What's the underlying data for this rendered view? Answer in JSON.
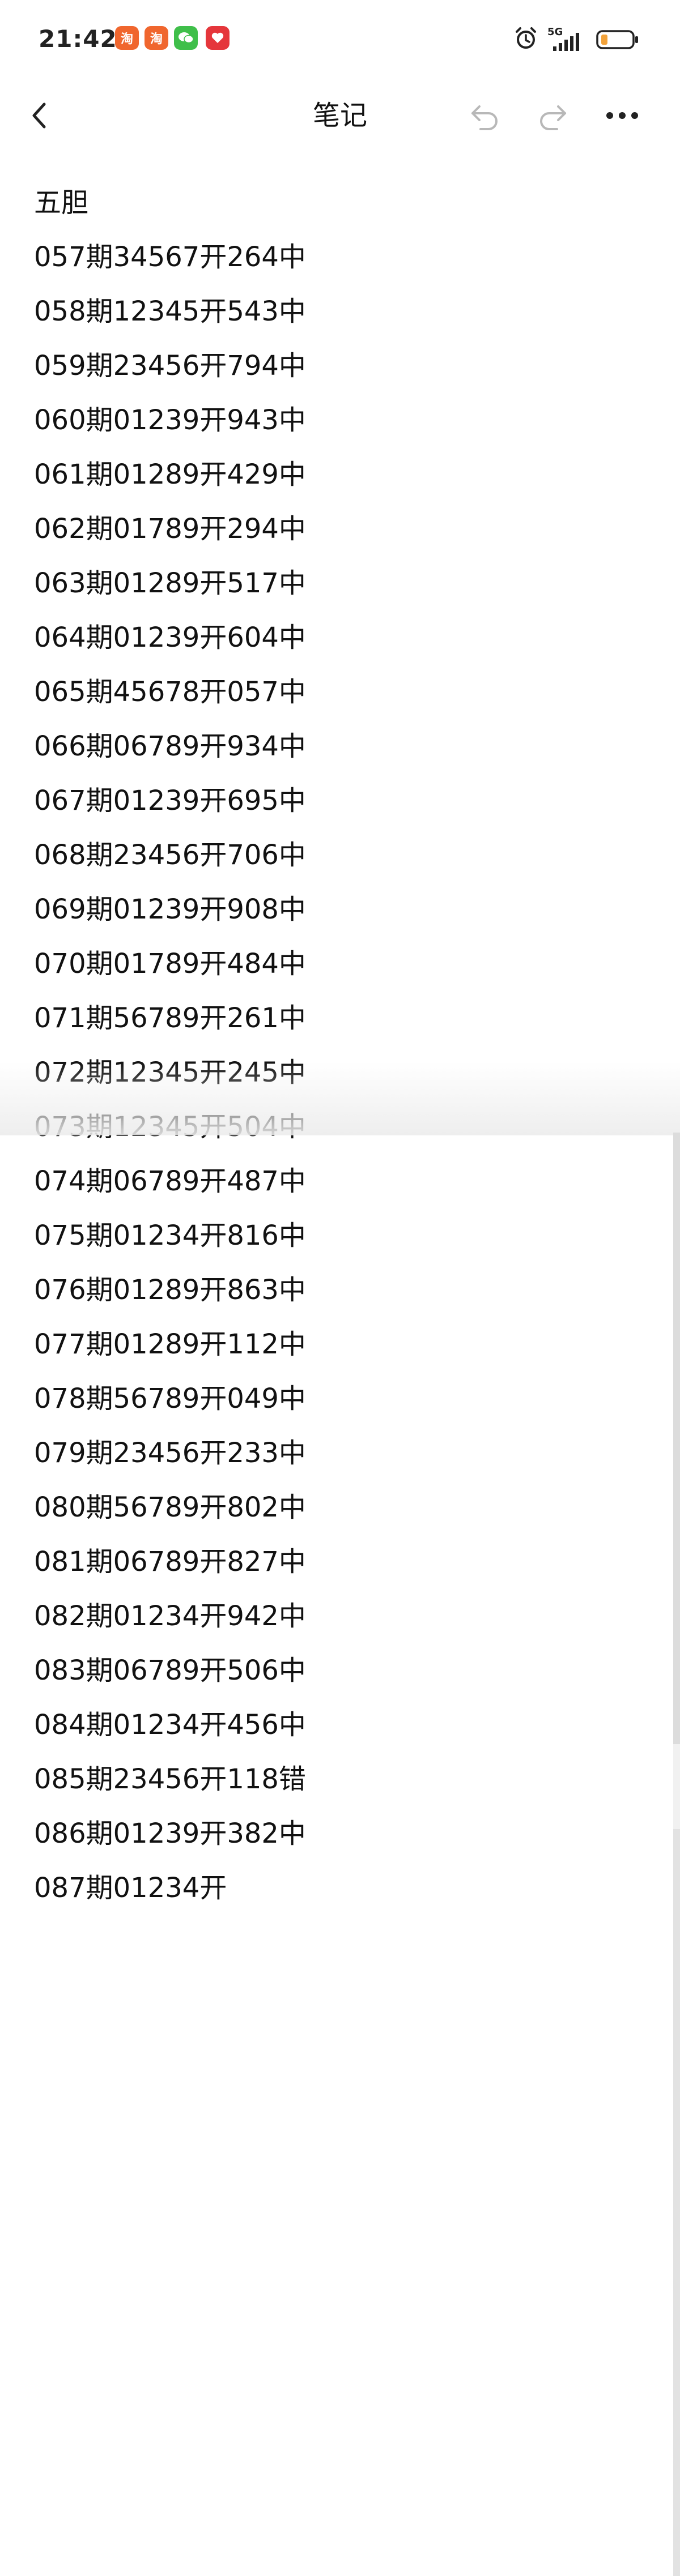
{
  "status_bar": {
    "time": "21:42",
    "network": "5G",
    "notifications": [
      "taobao-icon",
      "taobao-icon",
      "wechat-icon",
      "app-red-icon"
    ]
  },
  "header": {
    "title": "笔记",
    "back_icon": "chevron-left-icon",
    "undo_icon": "undo-icon",
    "redo_icon": "redo-icon",
    "more_icon": "more-horizontal-icon"
  },
  "note": {
    "heading": "五胆",
    "lines": [
      "057期34567开264中",
      "058期12345开543中",
      "059期23456开794中",
      "060期01239开943中",
      "061期01289开429中",
      "062期01789开294中",
      "063期01289开517中",
      "064期01239开604中",
      "065期45678开057中",
      "066期06789开934中",
      "067期01239开695中",
      "068期23456开706中",
      "069期01239开908中",
      "070期01789开484中",
      "071期56789开261中",
      "072期12345开245中",
      "073期12345开504中",
      "074期06789开487中",
      "075期01234开816中",
      "076期01289开863中",
      "077期01289开112中",
      "078期56789开049中",
      "079期23456开233中",
      "080期56789开802中",
      "081期06789开827中",
      "082期01234开942中",
      "083期06789开506中",
      "084期01234开456中",
      "085期23456开118错",
      "086期01239开382中",
      "087期01234开"
    ]
  },
  "colors": {
    "background": "#ffffff",
    "text": "#111111",
    "icon_disabled": "#b8b8b8"
  }
}
